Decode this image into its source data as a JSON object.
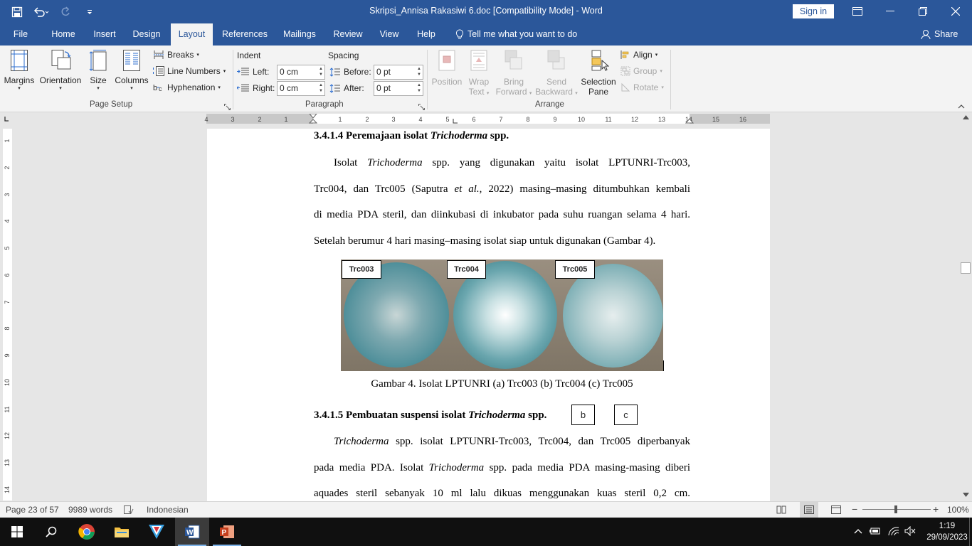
{
  "window": {
    "title": "Skripsi_Annisa Rakasiwi 6.doc [Compatibility Mode]  -  Word",
    "signin_label": "Sign in"
  },
  "tabs": [
    {
      "label": "File"
    },
    {
      "label": "Home"
    },
    {
      "label": "Insert"
    },
    {
      "label": "Design"
    },
    {
      "label": "Layout"
    },
    {
      "label": "References"
    },
    {
      "label": "Mailings"
    },
    {
      "label": "Review"
    },
    {
      "label": "View"
    },
    {
      "label": "Help"
    }
  ],
  "tell_me": "Tell me what you want to do",
  "share": "Share",
  "ribbon": {
    "page_setup": {
      "group_label": "Page Setup",
      "margins": "Margins",
      "orientation": "Orientation",
      "size": "Size",
      "columns": "Columns",
      "breaks": "Breaks",
      "line_numbers": "Line Numbers",
      "hyphenation": "Hyphenation"
    },
    "paragraph": {
      "group_label": "Paragraph",
      "indent_header": "Indent",
      "spacing_header": "Spacing",
      "left_label": "Left:",
      "left_value": "0 cm",
      "right_label": "Right:",
      "right_value": "0 cm",
      "before_label": "Before:",
      "before_value": "0 pt",
      "after_label": "After:",
      "after_value": "0 pt"
    },
    "arrange": {
      "group_label": "Arrange",
      "position": "Position",
      "wrap_text_1": "Wrap",
      "wrap_text_2": "Text",
      "bring_forward_1": "Bring",
      "bring_forward_2": "Forward",
      "send_backward_1": "Send",
      "send_backward_2": "Backward",
      "selection_pane_1": "Selection",
      "selection_pane_2": "Pane",
      "align": "Align",
      "group": "Group",
      "rotate": "Rotate"
    }
  },
  "ruler": {
    "left_ticks": [
      "4",
      "3",
      "2",
      "1"
    ],
    "right_ticks": [
      "1",
      "2",
      "3",
      "4",
      "5",
      "6",
      "7",
      "8",
      "9",
      "10",
      "11",
      "12",
      "13",
      "14",
      "15",
      "16"
    ],
    "vertical_ticks": [
      "1",
      "2",
      "3",
      "4",
      "5",
      "6",
      "7",
      "8",
      "9",
      "10",
      "11",
      "12",
      "13",
      "14"
    ]
  },
  "document": {
    "heading1_prefix": "3.4.1.4 Peremajaan isolat ",
    "heading1_italic": "Trichoderma",
    "heading1_suffix": " spp.",
    "p1_l1_a": "Isolat ",
    "p1_l1_i": "Trichoderma",
    "p1_l1_b": " spp. yang digunakan yaitu isolat LPTUNRI-Trc003,",
    "p1_l2_a": "Trc004, dan Trc005 (Saputra ",
    "p1_l2_i": "et al.,",
    "p1_l2_b": " 2022) masing–masing ditumbuhkan kembali",
    "p1_l3": "di media PDA steril, dan diinkubasi di inkubator pada suhu ruangan selama 4 hari.",
    "p1_l4": "Setelah berumur 4 hari masing–masing isolat siap untuk digunakan (Gambar 4).",
    "figure_labels": [
      "Trc003",
      "Trc004",
      "Trc005"
    ],
    "caption": "Gambar 4. Isolat LPTUNRI (a) Trc003 (b) Trc004 (c) Trc005",
    "heading2_prefix": "3.4.1.5 Pembuatan suspensi isolat ",
    "heading2_italic": "Trichoderma",
    "heading2_suffix": " spp.",
    "box_b": "b",
    "box_c": "c",
    "p2_l1_i": "Trichoderma",
    "p2_l1_b": " spp. isolat LPTUNRI-Trc003, Trc004, dan Trc005 diperbanyak",
    "p2_l2_a": "pada media PDA. Isolat ",
    "p2_l2_i": "Trichoderma",
    "p2_l2_b": " spp. pada media PDA masing-masing diberi",
    "p2_l3": "aquades steril sebanyak 10 ml lalu dikuas menggunakan kuas steril 0,2 cm."
  },
  "status": {
    "page": "Page 23 of 57",
    "words": "9989 words",
    "language": "Indonesian",
    "zoom": "100%"
  },
  "taskbar": {
    "time": "1:19",
    "date": "29/09/2023"
  }
}
